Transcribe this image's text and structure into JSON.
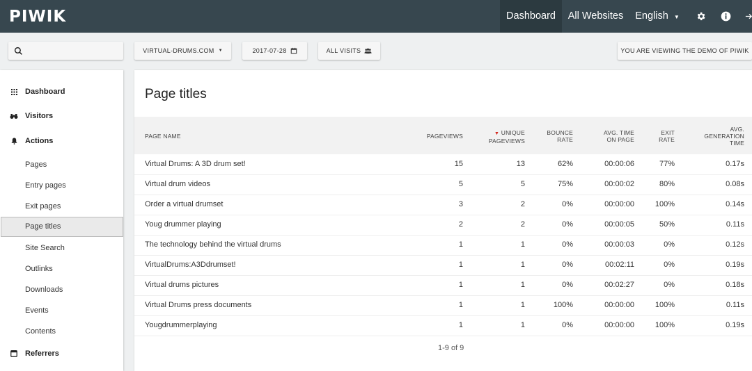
{
  "topbar": {
    "logo": "PIWIK",
    "nav": {
      "dashboard": "Dashboard",
      "all_websites": "All Websites",
      "language": "English"
    },
    "icons": [
      "gear-icon",
      "info-icon",
      "logout-icon"
    ]
  },
  "controls": {
    "search_placeholder": "",
    "site": "VIRTUAL-DRUMS.COM",
    "date": "2017-07-28",
    "segment": "ALL VISITS",
    "demo_notice": "YOU ARE VIEWING THE DEMO OF PIWIK"
  },
  "sidebar": {
    "dashboard": "Dashboard",
    "visitors": "Visitors",
    "actions": "Actions",
    "action_items": [
      "Pages",
      "Entry pages",
      "Exit pages",
      "Page titles",
      "Site Search",
      "Outlinks",
      "Downloads",
      "Events",
      "Contents"
    ],
    "active_item": "Page titles",
    "referrers": "Referrers"
  },
  "report": {
    "title": "Page titles",
    "columns": {
      "name": "PAGE NAME",
      "pageviews": "PAGEVIEWS",
      "unique_1": "UNIQUE",
      "unique_2": "PAGEVIEWS",
      "bounce_1": "BOUNCE",
      "bounce_2": "RATE",
      "avgtime_1": "AVG. TIME",
      "avgtime_2": "ON PAGE",
      "exit_1": "EXIT",
      "exit_2": "RATE",
      "gen_1": "AVG.",
      "gen_2": "GENERATION",
      "gen_3": "TIME"
    },
    "rows": [
      {
        "name": "Virtual Drums: A 3D drum set!",
        "pageviews": "15",
        "unique": "13",
        "bounce": "62%",
        "avgtime": "00:00:06",
        "exit": "77%",
        "gen": "0.17s"
      },
      {
        "name": "Virtual drum videos",
        "pageviews": "5",
        "unique": "5",
        "bounce": "75%",
        "avgtime": "00:00:02",
        "exit": "80%",
        "gen": "0.08s"
      },
      {
        "name": "Order a virtual drumset",
        "pageviews": "3",
        "unique": "2",
        "bounce": "0%",
        "avgtime": "00:00:00",
        "exit": "100%",
        "gen": "0.14s"
      },
      {
        "name": "Youg drummer playing",
        "pageviews": "2",
        "unique": "2",
        "bounce": "0%",
        "avgtime": "00:00:05",
        "exit": "50%",
        "gen": "0.11s"
      },
      {
        "name": "The technology behind the virtual drums",
        "pageviews": "1",
        "unique": "1",
        "bounce": "0%",
        "avgtime": "00:00:03",
        "exit": "0%",
        "gen": "0.12s"
      },
      {
        "name": "VirtualDrums:A3Ddrumset!",
        "pageviews": "1",
        "unique": "1",
        "bounce": "0%",
        "avgtime": "00:02:11",
        "exit": "0%",
        "gen": "0.19s"
      },
      {
        "name": "Virtual drums pictures",
        "pageviews": "1",
        "unique": "1",
        "bounce": "0%",
        "avgtime": "00:02:27",
        "exit": "0%",
        "gen": "0.18s"
      },
      {
        "name": "Virtual Drums press documents",
        "pageviews": "1",
        "unique": "1",
        "bounce": "100%",
        "avgtime": "00:00:00",
        "exit": "100%",
        "gen": "0.11s"
      },
      {
        "name": "Yougdrummerplaying",
        "pageviews": "1",
        "unique": "1",
        "bounce": "0%",
        "avgtime": "00:00:00",
        "exit": "100%",
        "gen": "0.19s"
      }
    ],
    "pagination": "1-9 of 9"
  }
}
